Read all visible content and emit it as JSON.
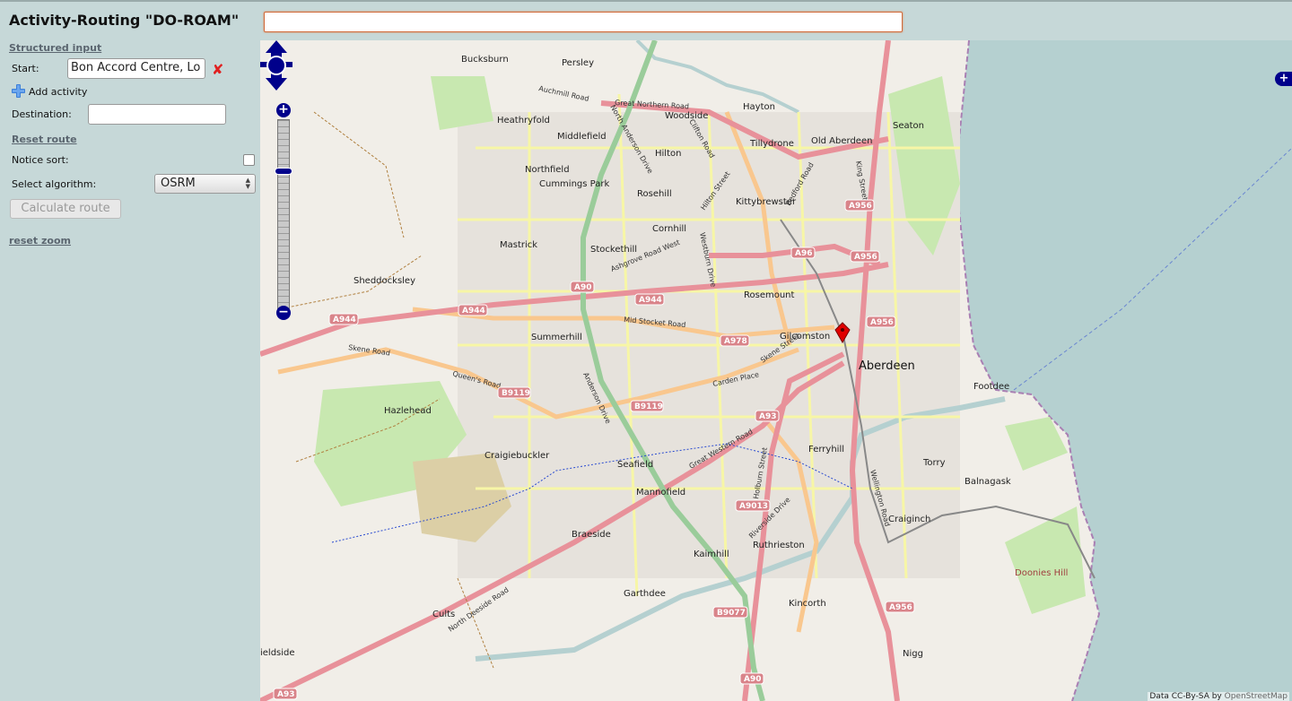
{
  "header": {
    "title": "Activity-Routing \"DO-ROAM\"",
    "search_value": ""
  },
  "sidebar": {
    "structured_input_link": "Structured input",
    "start_label": "Start:",
    "start_value": "Bon Accord Centre, Lo",
    "add_activity_label": "Add activity",
    "destination_label": "Destination:",
    "destination_value": "",
    "reset_route_link": "Reset route",
    "notice_sort_label": "Notice sort:",
    "notice_sort_checked": false,
    "select_algorithm_label": "Select algorithm:",
    "algorithm_selected": "OSRM",
    "calculate_button": "Calculate route",
    "reset_zoom_link": "reset zoom"
  },
  "map": {
    "places": {
      "bucksburn": "Bucksburn",
      "persley": "Persley",
      "heathryfold": "Heathryfold",
      "woodside": "Woodside",
      "hayton": "Hayton",
      "middlefield": "Middlefield",
      "tillydrone": "Tillydrone",
      "old_aberdeen": "Old Aberdeen",
      "seaton": "Seaton",
      "hilton": "Hilton",
      "northfield": "Northfield",
      "cummings_park": "Cummings Park",
      "rosehill": "Rosehill",
      "kittybrewster": "Kittybrewster",
      "cornhill": "Cornhill",
      "mastrick": "Mastrick",
      "stockethill": "Stockethill",
      "sheddocksley": "Sheddocksley",
      "rosemount": "Rosemount",
      "summerhill": "Summerhill",
      "gilcomston": "Gilcomston",
      "aberdeen": "Aberdeen",
      "footdee": "Footdee",
      "hazlehead": "Hazlehead",
      "ferryhill": "Ferryhill",
      "torry": "Torry",
      "craigiebuckler": "Craigiebuckler",
      "seafield": "Seafield",
      "balnagask": "Balnagask",
      "mannofield": "Mannofield",
      "craiginch": "Craiginch",
      "braeside": "Braeside",
      "ruthrieston": "Ruthrieston",
      "kaimhill": "Kaimhill",
      "doonies_hill": "Doonies Hill",
      "garthdee": "Garthdee",
      "kincorth": "Kincorth",
      "cults": "Cults",
      "bieldside": "ieldside",
      "nigg": "Nigg"
    },
    "roads": {
      "auchmill": "Auchmill Road",
      "great_northern": "Great Northern Road",
      "clifton": "Clifton Road",
      "north_anderson": "North Anderson Drive",
      "hilton_street": "Hilton Street",
      "bedford": "Bedford Road",
      "king_street": "King Street",
      "ashgrove_west": "Ashgrove Road West",
      "westburn": "Westburn Drive",
      "mid_stocket": "Mid Stocket Road",
      "skene_road": "Skene Road",
      "queens_road": "Queen's Road",
      "skene_street": "Skene Street",
      "carden_place": "Carden Place",
      "anderson_drive": "Anderson Drive",
      "great_western": "Great Western Road",
      "holburn_street": "Holburn Street",
      "riverside_drive": "Riverside Drive",
      "wellington": "Wellington Road",
      "north_deeside": "North Deeside Road"
    },
    "shields": {
      "a956": "A956",
      "a96": "A96",
      "a90": "A90",
      "a944": "A944",
      "a978": "A978",
      "b9119": "B9119",
      "a93": "A93",
      "a9013": "A9013",
      "b9077": "B9077"
    },
    "attribution_prefix": "Data CC-By-SA by ",
    "attribution_link": "OpenStreetMap",
    "zoom_in": "+",
    "zoom_out": "−",
    "layer_switcher": "+"
  },
  "colors": {
    "panel_bg": "#c6d8d8",
    "sea": "#b5d0d0",
    "map_bg": "#f1eee8",
    "motorway": "#e8919a",
    "primary": "#f9c78e",
    "secondary": "#f7f6a6",
    "park": "#c8e8b0",
    "control_blue": "#00008b",
    "marker_red": "#e00000"
  }
}
